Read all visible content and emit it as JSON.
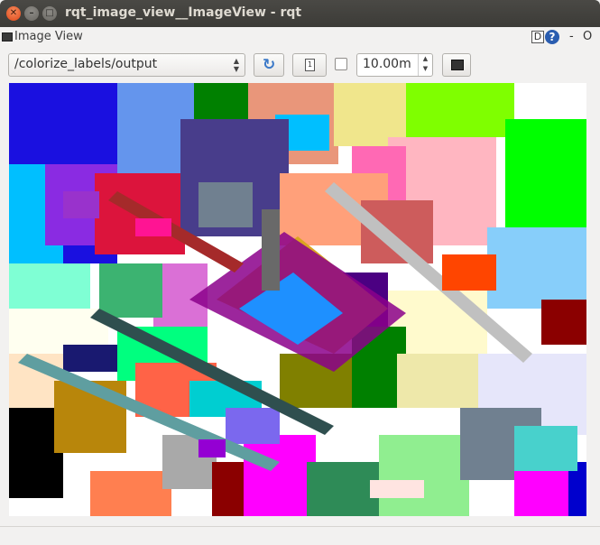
{
  "window": {
    "title": "rqt_image_view__ImageView - rqt",
    "close_glyph": "✕",
    "minimize_glyph": "–",
    "maximize_glyph": "□"
  },
  "dock": {
    "title": "Image View",
    "help_d": "D",
    "help_q": "?",
    "dash": "-",
    "float": "O"
  },
  "toolbar": {
    "topic": "/colorize_labels/output",
    "timeout_value": "10.00m",
    "spin_up": "▲",
    "spin_down": "▼",
    "combo_up": "▲",
    "combo_down": "▼",
    "refresh_icon": "refresh-icon",
    "pan_icon": "zoom-fit-icon",
    "save_icon": "save-image-icon"
  },
  "image": {
    "description_colors": [
      "#1a10e0",
      "#ffa07a",
      "#00ff00",
      "#ffc0cb",
      "#00bfff",
      "#ffd700",
      "#ff00ff",
      "#000000",
      "#1e90ff",
      "#008000",
      "#8b0000",
      "#7fffd4"
    ]
  }
}
